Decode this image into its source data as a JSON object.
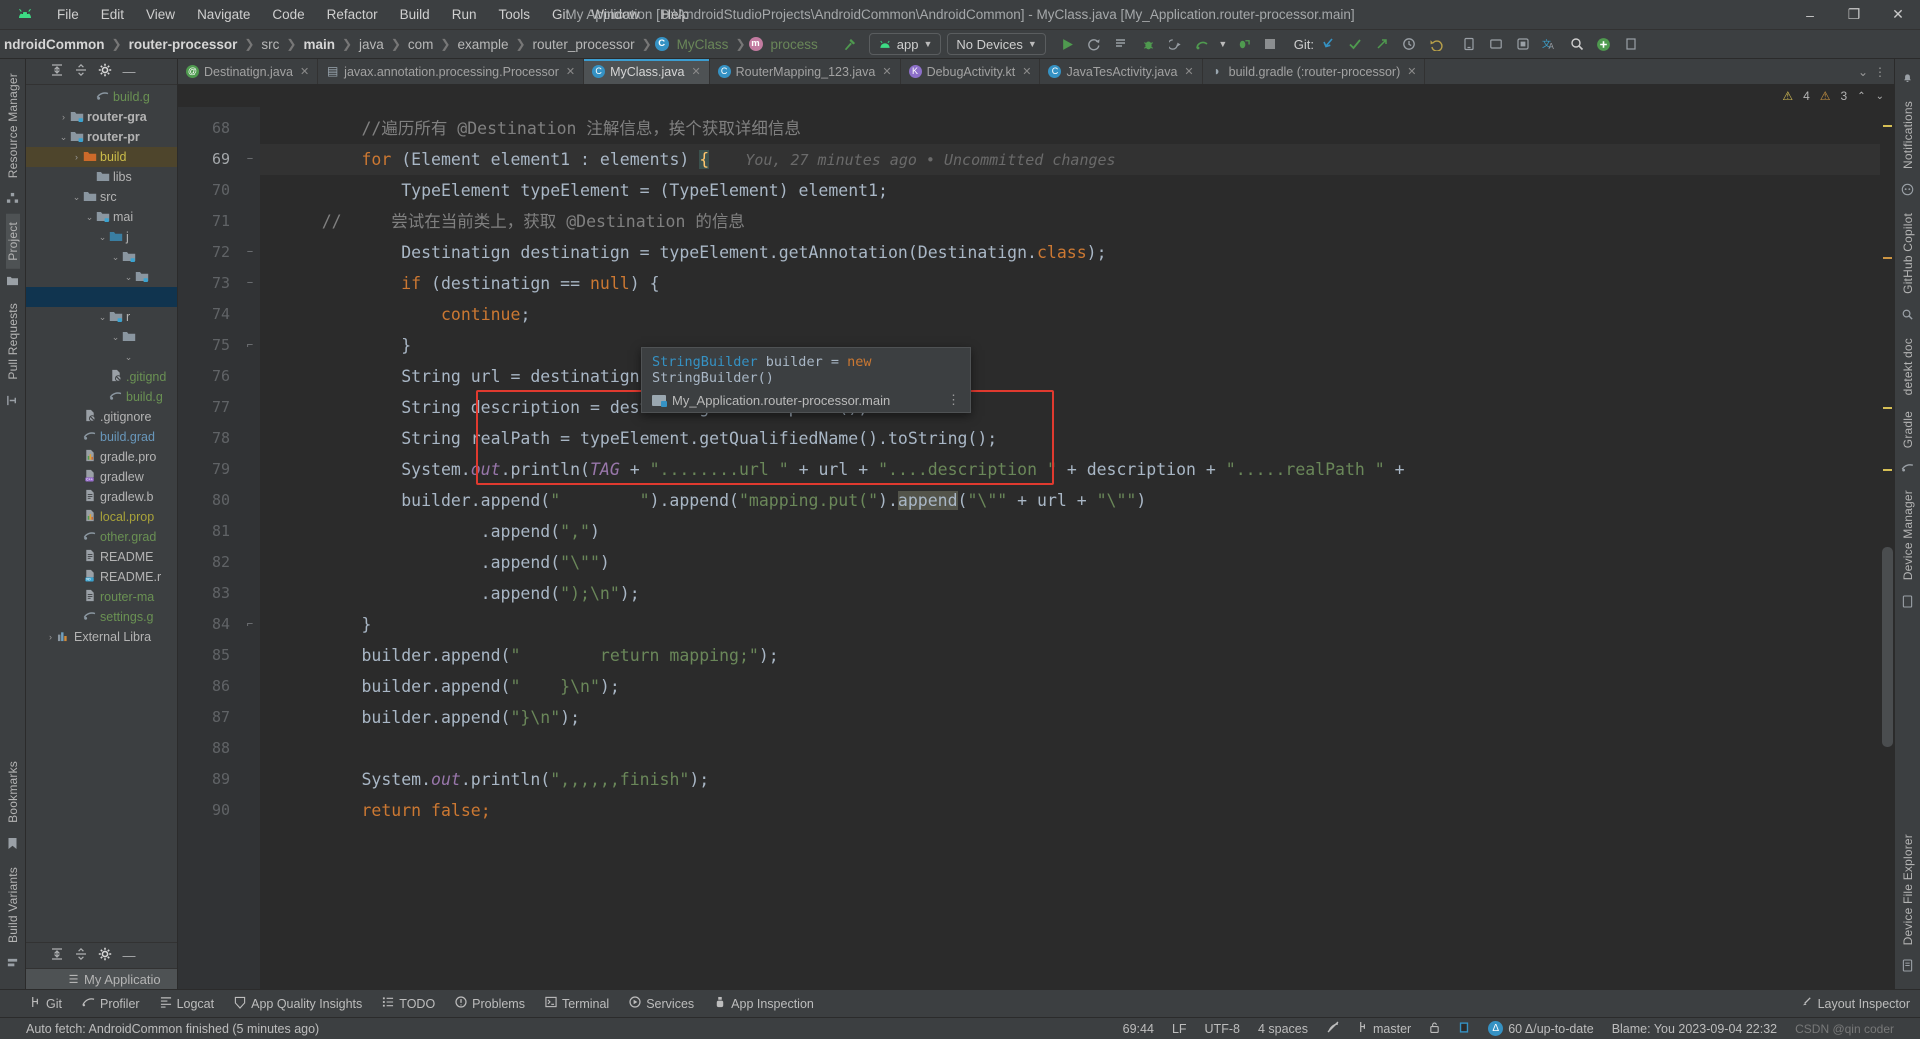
{
  "window": {
    "title": "My Application [D:\\AndroidStudioProjects\\AndroidCommon\\AndroidCommon] - MyClass.java [My_Application.router-processor.main]",
    "logo": "android-icon",
    "minimize": "–",
    "maximize": "❐",
    "close": "✕"
  },
  "menu": [
    "File",
    "Edit",
    "View",
    "Navigate",
    "Code",
    "Refactor",
    "Build",
    "Run",
    "Tools",
    "Git",
    "Window",
    "Help"
  ],
  "breadcrumbs": [
    {
      "label": "ndroidCommon",
      "bold": true
    },
    {
      "label": "router-processor",
      "bold": true
    },
    {
      "label": "src",
      "bold": false
    },
    {
      "label": "main",
      "bold": true
    },
    {
      "label": "java",
      "bold": false
    },
    {
      "label": "com",
      "bold": false
    },
    {
      "label": "example",
      "bold": false
    },
    {
      "label": "router_processor",
      "bold": false
    },
    {
      "label": "MyClass",
      "bold": false,
      "icon": "class-icon"
    },
    {
      "label": "process",
      "bold": false,
      "icon": "method-icon"
    }
  ],
  "toolbar": {
    "build_icon": "hammer-icon",
    "module_selector": "app",
    "device_selector": "No Devices",
    "run_icon": "run-icon",
    "rerun_icon": "rerun-icon",
    "run_with_coverage_icon": "coverage-icon",
    "debug_icon": "debug-icon",
    "attach_debugger_icon": "attach-debugger-icon",
    "profile_icon": "profile-icon",
    "profile_dropdown_icon": "chevron-down-icon",
    "apply_changes_icon": "apply-changes-icon",
    "stop_icon": "stop-icon",
    "git_label": "Git:",
    "git_update_icon": "update-project-icon",
    "git_commit_icon": "commit-icon",
    "git_push_icon": "push-icon",
    "history_icon": "history-icon",
    "undo_icon": "undo-icon",
    "device_manager_icon": "device-manager-icon",
    "avd_icon": "avd-icon",
    "sdk_icon": "sdk-icon",
    "translate_icon": "translate-icon",
    "search_icon": "search-icon",
    "account_icon": "account-icon",
    "more_icon": "more-icon"
  },
  "left_strips": {
    "outer": [
      "Resource Manager",
      "Project",
      "Pull Requests",
      "Bookmarks",
      "Build Variants",
      "Structure"
    ],
    "selected": "Project",
    "icons": [
      "resource-manager-icon",
      "project-icon",
      "pull-requests-icon",
      "bookmarks-icon",
      "build-variants-icon",
      "structure-icon"
    ]
  },
  "project_panel": {
    "toolbar_icons": [
      "expand-all-icon",
      "collapse-all-icon",
      "settings-gear-icon",
      "hide-icon"
    ],
    "tree": [
      {
        "indent": 4,
        "arrow": "",
        "icon": "gradle-icon",
        "label": "build.g",
        "color": "green",
        "state": "none"
      },
      {
        "indent": 2,
        "arrow": "›",
        "icon": "module-icon",
        "label": "router-gra",
        "color": "grey",
        "state": "none",
        "bold": true
      },
      {
        "indent": 2,
        "arrow": "⌄",
        "icon": "module-icon",
        "label": "router-pr",
        "color": "grey",
        "state": "none",
        "bold": true
      },
      {
        "indent": 3,
        "arrow": "›",
        "icon": "build-folder-icon",
        "label": "build",
        "color": "yellow",
        "state": "brown"
      },
      {
        "indent": 4,
        "arrow": "",
        "icon": "folder-icon",
        "label": "libs",
        "color": "grey",
        "state": "none"
      },
      {
        "indent": 3,
        "arrow": "⌄",
        "icon": "folder-icon",
        "label": "src",
        "color": "grey",
        "state": "none"
      },
      {
        "indent": 4,
        "arrow": "⌄",
        "icon": "source-folder-icon",
        "label": "mai",
        "color": "grey",
        "state": "none"
      },
      {
        "indent": 5,
        "arrow": "⌄",
        "icon": "java-folder-icon",
        "label": "j",
        "color": "grey",
        "state": "none"
      },
      {
        "indent": 6,
        "arrow": "⌄",
        "icon": "package-icon",
        "label": "",
        "color": "grey",
        "state": "none"
      },
      {
        "indent": 7,
        "arrow": "⌄",
        "icon": "package-icon",
        "label": "",
        "color": "grey",
        "state": "none"
      },
      {
        "indent": 7,
        "arrow": "",
        "icon": "",
        "label": "",
        "color": "grey",
        "state": "blue"
      },
      {
        "indent": 5,
        "arrow": "⌄",
        "icon": "resources-folder-icon",
        "label": "r",
        "color": "grey",
        "state": "none"
      },
      {
        "indent": 6,
        "arrow": "⌄",
        "icon": "folder-icon",
        "label": "",
        "color": "grey",
        "state": "none"
      },
      {
        "indent": 7,
        "arrow": "⌄",
        "icon": "",
        "label": "",
        "color": "grey",
        "state": "none"
      },
      {
        "indent": 5,
        "arrow": "",
        "icon": "gitignore-icon",
        "label": ".gitignd",
        "color": "green",
        "state": "none"
      },
      {
        "indent": 5,
        "arrow": "",
        "icon": "gradle-icon",
        "label": "build.g",
        "color": "green",
        "state": "none"
      },
      {
        "indent": 3,
        "arrow": "",
        "icon": "gitignore-icon",
        "label": ".gitignore",
        "color": "grey",
        "state": "none"
      },
      {
        "indent": 3,
        "arrow": "",
        "icon": "gradle-icon",
        "label": "build.grad",
        "color": "blue",
        "state": "none"
      },
      {
        "indent": 3,
        "arrow": "",
        "icon": "properties-icon",
        "label": "gradle.pro",
        "color": "grey",
        "state": "none"
      },
      {
        "indent": 3,
        "arrow": "",
        "icon": "shell-icon",
        "label": "gradlew",
        "color": "grey",
        "state": "none"
      },
      {
        "indent": 3,
        "arrow": "",
        "icon": "text-file-icon",
        "label": "gradlew.b",
        "color": "grey",
        "state": "none"
      },
      {
        "indent": 3,
        "arrow": "",
        "icon": "properties-icon",
        "label": "local.prop",
        "color": "olive",
        "state": "none"
      },
      {
        "indent": 3,
        "arrow": "",
        "icon": "gradle-icon",
        "label": "other.grad",
        "color": "green",
        "state": "none"
      },
      {
        "indent": 3,
        "arrow": "",
        "icon": "text-file-icon",
        "label": "README",
        "color": "grey",
        "state": "none"
      },
      {
        "indent": 3,
        "arrow": "",
        "icon": "markdown-icon",
        "label": "README.r",
        "color": "grey",
        "state": "none"
      },
      {
        "indent": 3,
        "arrow": "",
        "icon": "text-file-icon",
        "label": "router-ma",
        "color": "green",
        "state": "none"
      },
      {
        "indent": 3,
        "arrow": "",
        "icon": "gradle-icon",
        "label": "settings.g",
        "color": "green",
        "state": "none"
      },
      {
        "indent": 1,
        "arrow": "›",
        "icon": "library-icon",
        "label": "External Libra",
        "color": "grey",
        "state": "none"
      }
    ],
    "structure_toolbar_icons": [
      "expand-all-icon",
      "collapse-all-icon",
      "settings-gear-icon",
      "hide-icon"
    ],
    "structure_item": "My Applicatio",
    "structure_item_icon": "structure-list-icon"
  },
  "editor": {
    "tabs": [
      {
        "label": "Destinatign.java",
        "icon": "annotation-icon",
        "active": false
      },
      {
        "label": "javax.annotation.processing.Processor",
        "icon": "file-icon",
        "active": false
      },
      {
        "label": "MyClass.java",
        "icon": "class-icon",
        "active": true
      },
      {
        "label": "RouterMapping_123.java",
        "icon": "class-icon",
        "active": false
      },
      {
        "label": "DebugActivity.kt",
        "icon": "kotlin-icon",
        "active": false
      },
      {
        "label": "JavaTesActivity.java",
        "icon": "class-icon",
        "active": false
      },
      {
        "label": "build.gradle (:router-processor)",
        "icon": "gradle-icon",
        "active": false
      }
    ],
    "tabs_overflow_icon": "chevron-down-icon",
    "tabs_more_icon": "more-icon",
    "inspections": {
      "warnings": "4",
      "weak_warnings": "3",
      "caret_up_icon": "chevron-up-icon",
      "caret_down_icon": "chevron-down-icon",
      "inspection_icon": "inspection-eye-icon"
    },
    "lines": [
      {
        "no": "68",
        "fold": "",
        "current": false,
        "segments": [
          {
            "t": "        ",
            "c": ""
          },
          {
            "t": "//遍历所有 @Destination 注解信息，挨个获取详细信息",
            "c": "cmt"
          }
        ]
      },
      {
        "no": "69",
        "fold": "−",
        "current": true,
        "segments": [
          {
            "t": "        ",
            "c": ""
          },
          {
            "t": "for",
            "c": "kw"
          },
          {
            "t": " (Element element1 : elements) ",
            "c": ""
          },
          {
            "t": "{",
            "c": "brace-hl"
          },
          {
            "t": "    You, 27 minutes ago • Uncommitted changes",
            "c": "blame"
          }
        ]
      },
      {
        "no": "70",
        "fold": "",
        "current": false,
        "segments": [
          {
            "t": "            TypeElement typeElement = (TypeElement) element1;",
            "c": ""
          }
        ]
      },
      {
        "no": "71",
        "fold": "",
        "current": false,
        "segments": [
          {
            "t": "    //     尝试在当前类上，获取 @Destination 的信息",
            "c": "cmt"
          }
        ]
      },
      {
        "no": "72",
        "fold": "−",
        "current": false,
        "segments": [
          {
            "t": "            Destinatign destinatign = typeElement.getAnnotation(Destinatign.",
            "c": ""
          },
          {
            "t": "class",
            "c": "kw"
          },
          {
            "t": ");",
            "c": ""
          }
        ]
      },
      {
        "no": "73",
        "fold": "−",
        "current": false,
        "segments": [
          {
            "t": "            ",
            "c": ""
          },
          {
            "t": "if",
            "c": "kw"
          },
          {
            "t": " (destinatign == ",
            "c": ""
          },
          {
            "t": "null",
            "c": "kw"
          },
          {
            "t": ") {",
            "c": ""
          }
        ]
      },
      {
        "no": "74",
        "fold": "",
        "current": false,
        "segments": [
          {
            "t": "                ",
            "c": ""
          },
          {
            "t": "continue",
            "c": "kw"
          },
          {
            "t": ";",
            "c": ""
          }
        ]
      },
      {
        "no": "75",
        "fold": "⌐",
        "current": false,
        "segments": [
          {
            "t": "            }",
            "c": ""
          }
        ]
      },
      {
        "no": "76",
        "fold": "",
        "current": false,
        "segments": [
          {
            "t": "            String url = destinatign.url();",
            "c": ""
          }
        ]
      },
      {
        "no": "77",
        "fold": "",
        "current": false,
        "segments": [
          {
            "t": "            String description = destinatign.description();",
            "c": ""
          }
        ]
      },
      {
        "no": "78",
        "fold": "",
        "current": false,
        "segments": [
          {
            "t": "            String realPath = typeElement.getQualifiedName().toString();",
            "c": ""
          }
        ]
      },
      {
        "no": "79",
        "fold": "",
        "current": false,
        "segments": [
          {
            "t": "            System.",
            "c": ""
          },
          {
            "t": "out",
            "c": "stat"
          },
          {
            "t": ".println(",
            "c": ""
          },
          {
            "t": "TAG",
            "c": "stat"
          },
          {
            "t": " + ",
            "c": ""
          },
          {
            "t": "\"........url \"",
            "c": "str"
          },
          {
            "t": " + url + ",
            "c": ""
          },
          {
            "t": "\"....description \"",
            "c": "str"
          },
          {
            "t": " + description + ",
            "c": ""
          },
          {
            "t": "\".....realPath \"",
            "c": "str"
          },
          {
            "t": " +",
            "c": ""
          }
        ]
      },
      {
        "no": "80",
        "fold": "",
        "current": false,
        "segments": [
          {
            "t": "            builder.append(",
            "c": ""
          },
          {
            "t": "\"        \"",
            "c": "str"
          },
          {
            "t": ").append(",
            "c": ""
          },
          {
            "t": "\"mapping.put(\"",
            "c": "str"
          },
          {
            "t": ").",
            "c": ""
          },
          {
            "t": "append",
            "c": "hl-word"
          },
          {
            "t": "(",
            "c": ""
          },
          {
            "t": "\"\\\"\"",
            "c": "str"
          },
          {
            "t": " + url + ",
            "c": ""
          },
          {
            "t": "\"\\\"\"",
            "c": "str"
          },
          {
            "t": ")",
            "c": ""
          }
        ]
      },
      {
        "no": "81",
        "fold": "",
        "current": false,
        "segments": [
          {
            "t": "                    .append(",
            "c": ""
          },
          {
            "t": "\",\"",
            "c": "str"
          },
          {
            "t": ")",
            "c": ""
          }
        ]
      },
      {
        "no": "82",
        "fold": "",
        "current": false,
        "segments": [
          {
            "t": "                    .append(",
            "c": ""
          },
          {
            "t": "\"\\\"\"",
            "c": "str"
          },
          {
            "t": ")",
            "c": ""
          }
        ]
      },
      {
        "no": "83",
        "fold": "",
        "current": false,
        "segments": [
          {
            "t": "                    .append(",
            "c": ""
          },
          {
            "t": "\");\\n\"",
            "c": "str"
          },
          {
            "t": ");",
            "c": ""
          }
        ]
      },
      {
        "no": "84",
        "fold": "⌐",
        "current": false,
        "segments": [
          {
            "t": "        }",
            "c": ""
          }
        ]
      },
      {
        "no": "85",
        "fold": "",
        "current": false,
        "segments": [
          {
            "t": "        builder.append(",
            "c": ""
          },
          {
            "t": "\"        return mapping;\"",
            "c": "str"
          },
          {
            "t": ");",
            "c": ""
          }
        ]
      },
      {
        "no": "86",
        "fold": "",
        "current": false,
        "segments": [
          {
            "t": "        builder.append(",
            "c": ""
          },
          {
            "t": "\"    }\\n\"",
            "c": "str"
          },
          {
            "t": ");",
            "c": ""
          }
        ]
      },
      {
        "no": "87",
        "fold": "",
        "current": false,
        "segments": [
          {
            "t": "        builder.append(",
            "c": ""
          },
          {
            "t": "\"}\\n\"",
            "c": "str"
          },
          {
            "t": ");",
            "c": ""
          }
        ]
      },
      {
        "no": "88",
        "fold": "",
        "current": false,
        "segments": [
          {
            "t": "",
            "c": ""
          }
        ]
      },
      {
        "no": "89",
        "fold": "",
        "current": false,
        "segments": [
          {
            "t": "        System.",
            "c": ""
          },
          {
            "t": "out",
            "c": "stat"
          },
          {
            "t": ".println(",
            "c": ""
          },
          {
            "t": "\",,,,,,finish\"",
            "c": "str"
          },
          {
            "t": ");",
            "c": ""
          }
        ]
      },
      {
        "no": "90",
        "fold": "",
        "current": false,
        "segments": [
          {
            "t": "        ",
            "c": ""
          },
          {
            "t": "return false;",
            "c": "kw"
          }
        ]
      }
    ],
    "tooltip": {
      "line1_type": "StringBuilder",
      "line1_rest": " builder = ",
      "line1_kw": "new",
      "line1_tail": " StringBuilder()",
      "module": "My_Application.router-processor.main",
      "folder_icon": "module-folder-icon",
      "more_icon": "more-vertical-icon"
    }
  },
  "right_strip": {
    "items": [
      "Notifications",
      "Device Manager",
      "Gradle",
      "detekt doc",
      "GitHub Copilot",
      "Device File Explorer"
    ],
    "icons": [
      "notifications-icon",
      "device-manager-icon",
      "gradle-icon",
      "detekt-icon",
      "copilot-icon",
      "device-file-explorer-icon"
    ]
  },
  "bottom_bar": {
    "items": [
      {
        "label": "Git",
        "icon": "git-branch-icon"
      },
      {
        "label": "Profiler",
        "icon": "profiler-icon"
      },
      {
        "label": "Logcat",
        "icon": "logcat-icon"
      },
      {
        "label": "App Quality Insights",
        "icon": "app-quality-icon"
      },
      {
        "label": "TODO",
        "icon": "todo-icon"
      },
      {
        "label": "Problems",
        "icon": "problems-icon"
      },
      {
        "label": "Terminal",
        "icon": "terminal-icon"
      },
      {
        "label": "Services",
        "icon": "services-icon"
      },
      {
        "label": "App Inspection",
        "icon": "app-inspection-icon"
      }
    ],
    "right_label": "Layout Inspector",
    "right_icon": "layout-inspector-icon"
  },
  "status_bar": {
    "message": "Auto fetch: AndroidCommon finished (5 minutes ago)",
    "caret": "69:44",
    "line_sep": "LF",
    "encoding": "UTF-8",
    "indent": "4 spaces",
    "lens_icon": "inspection-off-icon",
    "branch": "master",
    "branch_icon": "git-branch-icon",
    "lock_icon": "lock-icon",
    "memory_icon": "memory-icon",
    "sync_badge": "Δ",
    "sync_text": "60 Δ/up-to-date",
    "blame": "Blame: You 2023-09-04 22:32",
    "watermark": "CSDN @qin coder",
    "chrome_icon": "chrome-icon"
  }
}
